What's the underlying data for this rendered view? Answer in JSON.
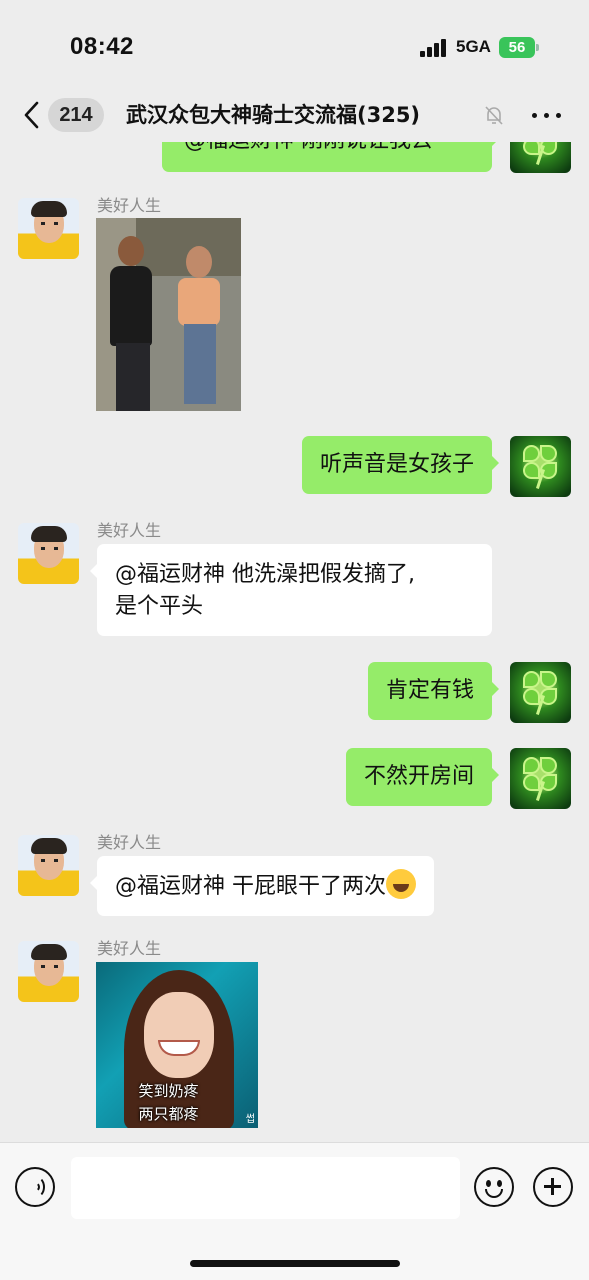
{
  "status_bar": {
    "time": "08:42",
    "network": "5GA",
    "battery": "56"
  },
  "header": {
    "back_count": "214",
    "title": "武汉众包大神骑士交流福(325)"
  },
  "messages": [
    {
      "side": "right",
      "text": "@福运财神 刚刚说让我去",
      "partial": true
    },
    {
      "side": "left",
      "sender": "美好人生",
      "type": "image"
    },
    {
      "side": "right",
      "text": "听声音是女孩子"
    },
    {
      "side": "left",
      "sender": "美好人生",
      "lines": [
        "@福运财神 他洗澡把假发摘了,",
        "是个平头"
      ]
    },
    {
      "side": "right",
      "text": "肯定有钱"
    },
    {
      "side": "right",
      "text": "不然开房间"
    },
    {
      "side": "left",
      "sender": "美好人生",
      "text": "@福运财神 干屁眼干了两次",
      "emoji": "laughing-crying"
    },
    {
      "side": "left",
      "sender": "美好人生",
      "type": "sticker",
      "caption_1": "笑到奶疼",
      "caption_2": "两只都疼",
      "watermark": "썹"
    }
  ],
  "input_bar": {
    "placeholder": ""
  },
  "colors": {
    "background": "#ededed",
    "my_bubble": "#95ec69",
    "other_bubble": "#ffffff"
  }
}
